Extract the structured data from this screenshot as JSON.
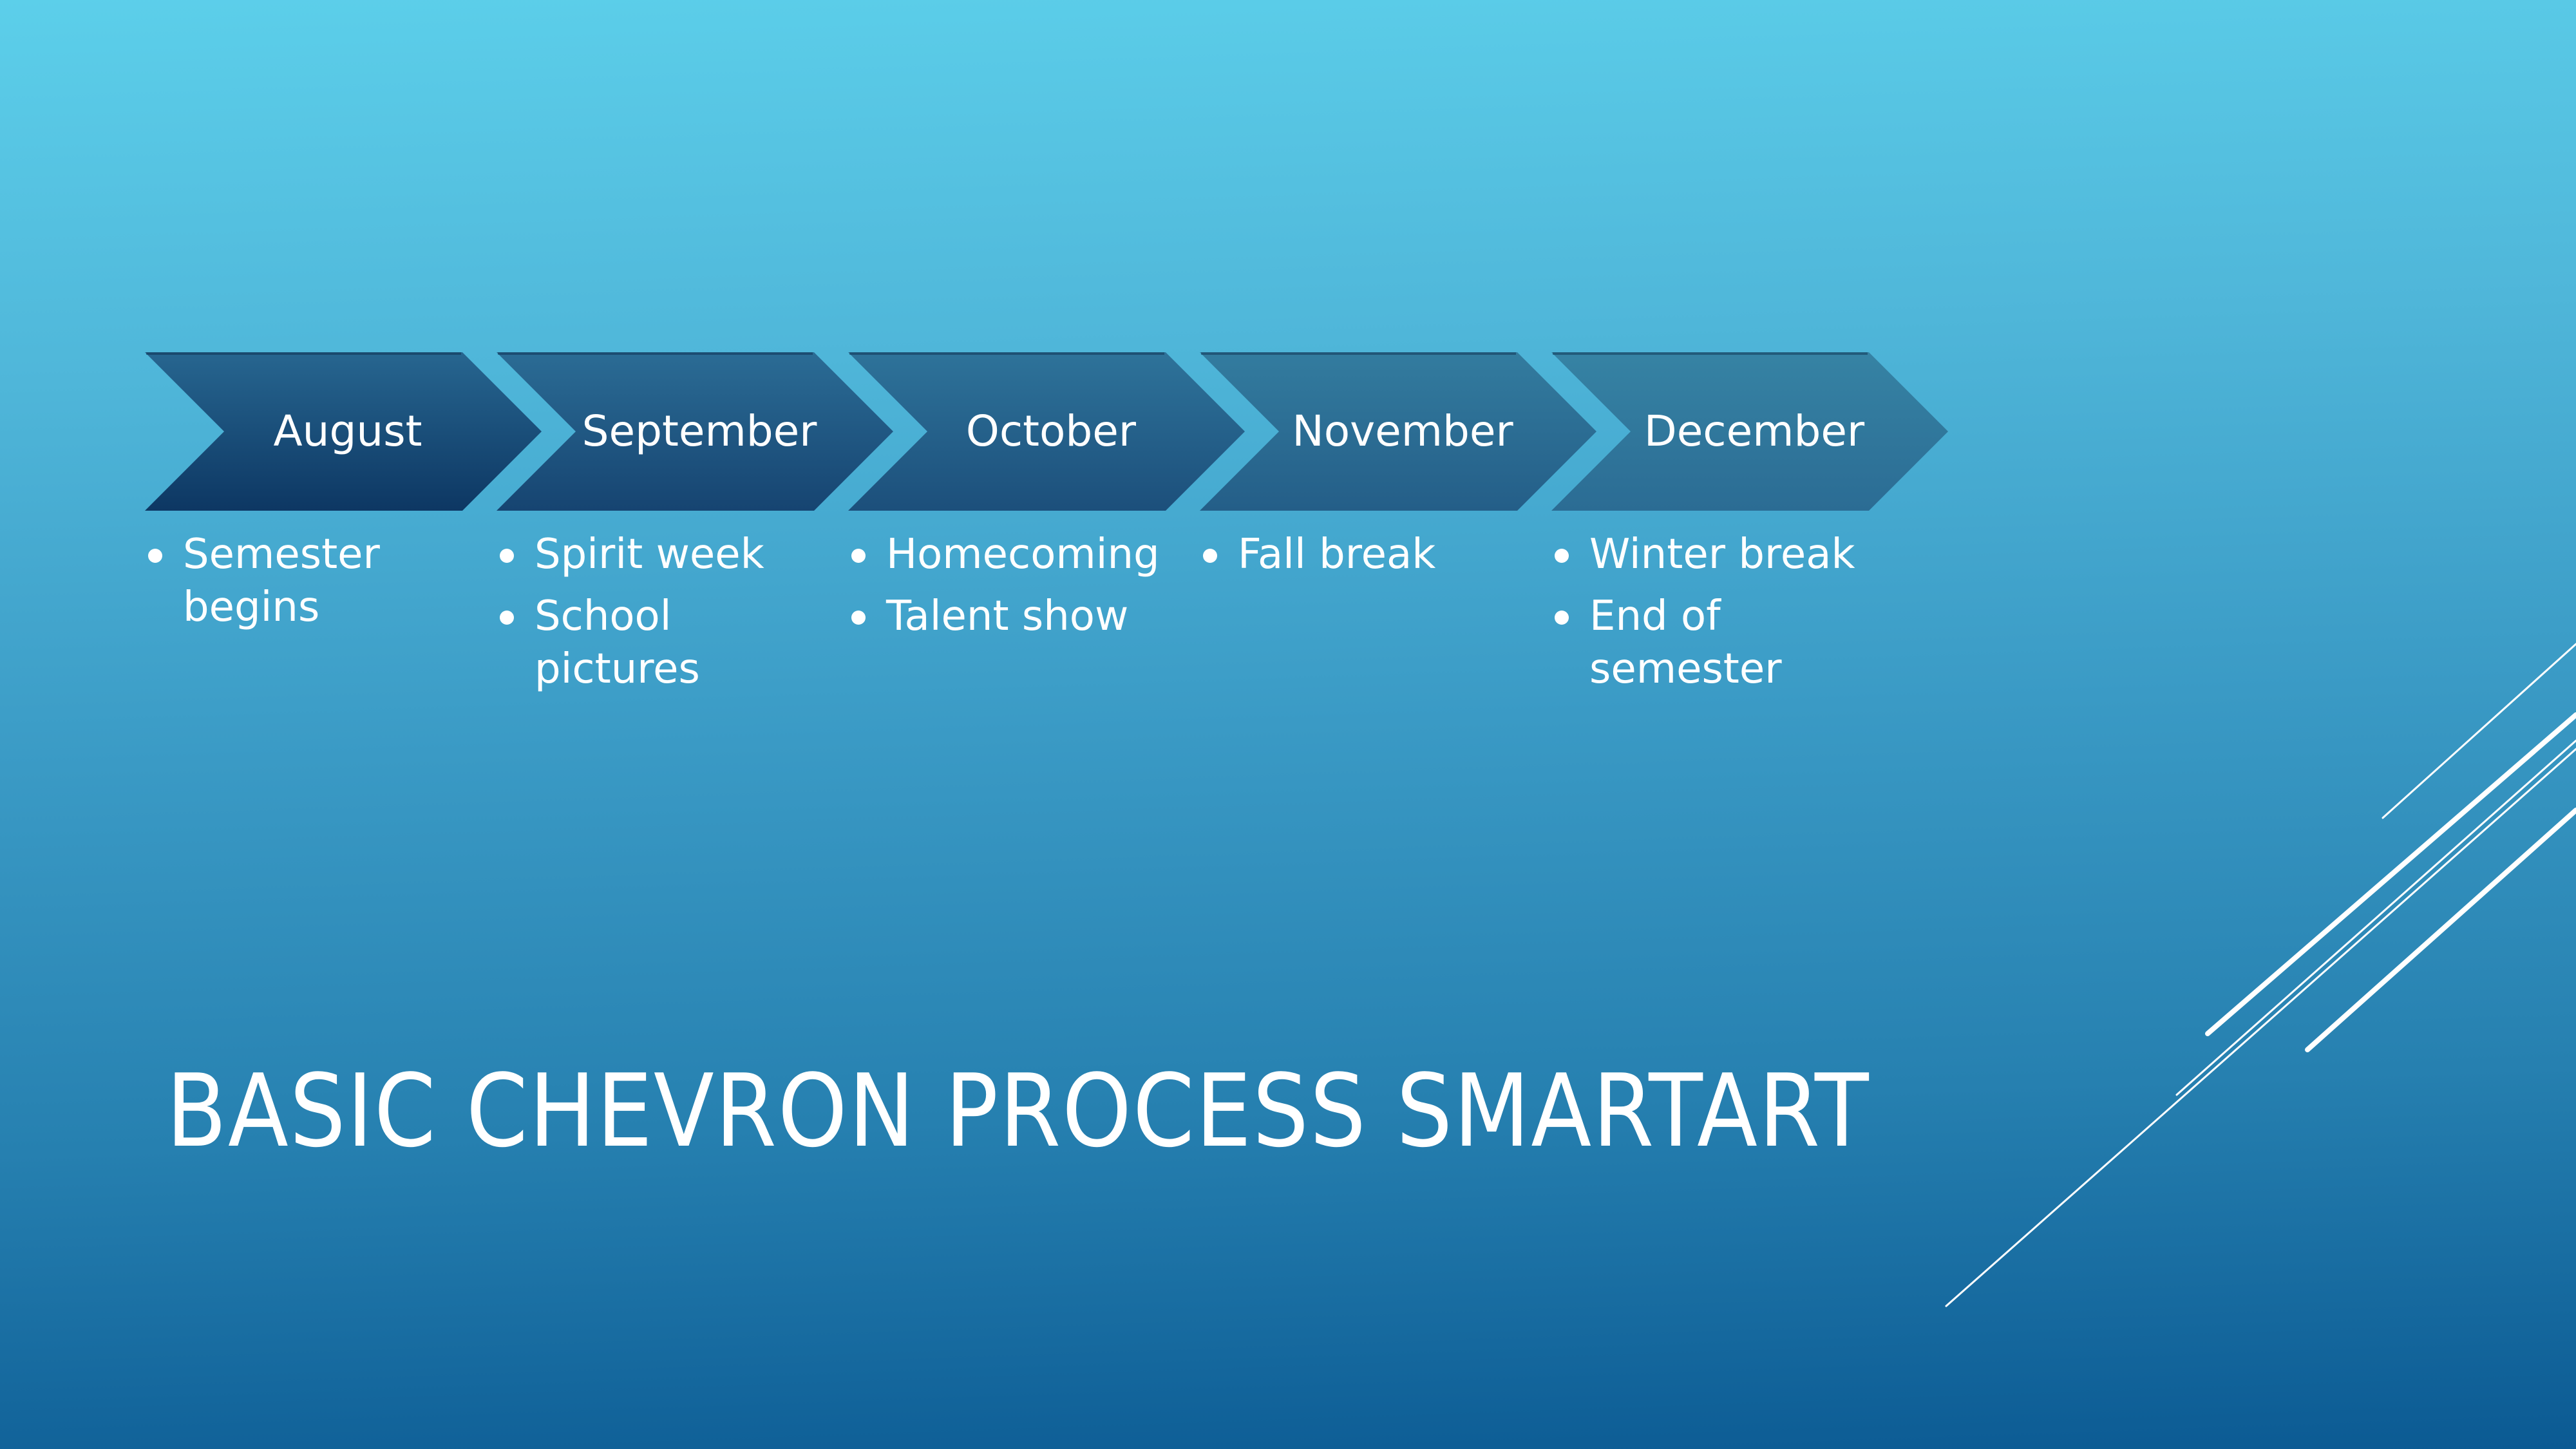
{
  "slide": {
    "title": "BASIC CHEVRON PROCESS SMARTART",
    "colors": {
      "background_top": "#5ccfea",
      "background_bottom": "#0b5a93",
      "chevron_gap": "#4ab3d8",
      "text": "#ffffff",
      "decor_lines": "#ffffff"
    },
    "steps": [
      {
        "label": "August",
        "color_top": "#276690",
        "color_bottom": "#0d3763",
        "bullets": [
          "Semester begins"
        ]
      },
      {
        "label": "September",
        "color_top": "#2b6c95",
        "color_bottom": "#164471",
        "bullets": [
          "Spirit week",
          "School pictures"
        ]
      },
      {
        "label": "October",
        "color_top": "#2e739a",
        "color_bottom": "#1c4f7b",
        "bullets": [
          "Homecoming",
          "Talent show"
        ]
      },
      {
        "label": "November",
        "color_top": "#337c9f",
        "color_bottom": "#245e88",
        "bullets": [
          "Fall break"
        ]
      },
      {
        "label": "December",
        "color_top": "#3683a4",
        "color_bottom": "#2b6c94",
        "bullets": [
          "Winter break",
          "End of semester"
        ]
      }
    ]
  }
}
